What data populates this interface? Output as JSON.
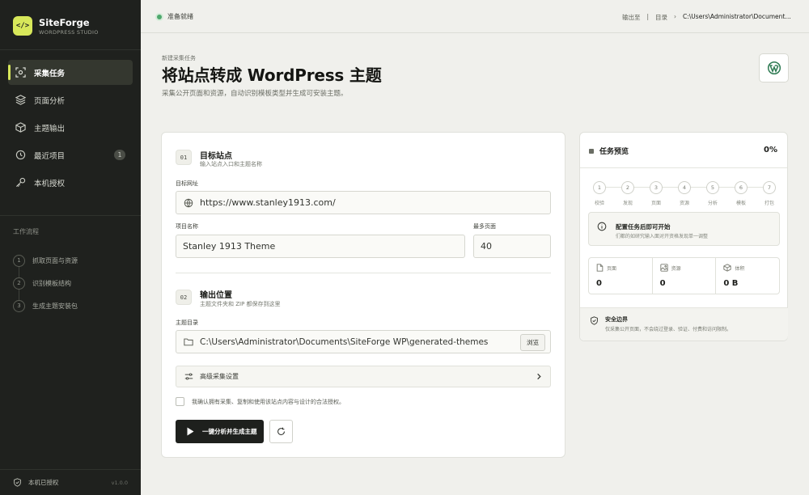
{
  "app": {
    "name": "SiteForge",
    "subtitle": "WORDPRESS STUDIO",
    "logo_glyph": "</>",
    "accent": "#d7e75a",
    "version": "v1.0.0"
  },
  "sidebar": {
    "items": [
      {
        "label": "采集任务",
        "icon": "scan-icon",
        "active": true
      },
      {
        "label": "页面分析",
        "icon": "layers-icon"
      },
      {
        "label": "主题输出",
        "icon": "box-icon"
      },
      {
        "label": "最近项目",
        "icon": "clock-icon",
        "badge": "1"
      },
      {
        "label": "本机授权",
        "icon": "key-icon"
      }
    ],
    "workflow_label": "工作流程",
    "workflow": [
      {
        "num": "1",
        "label": "抓取页面与资源"
      },
      {
        "num": "2",
        "label": "识别模板结构"
      },
      {
        "num": "3",
        "label": "生成主题安装包"
      }
    ],
    "footer": {
      "label": "本机已授权",
      "version": "v1.0.0"
    }
  },
  "topbar": {
    "status": "准备就绪",
    "breadcrumb": [
      "输出至",
      "目录"
    ],
    "path": "C:\\Users\\Administrator\\Documents\\SiteForge WP"
  },
  "header": {
    "eyebrow": "新建采集任务",
    "title": "将站点转成 WordPress 主题",
    "subtitle": "采集公开页面和资源，自动识别模板类型并生成可安装主题。"
  },
  "form": {
    "section1": {
      "no": "01",
      "title": "目标站点",
      "subtitle": "输入站点入口和主题名称"
    },
    "url_label": "目标网址",
    "url_value": "https://www.stanley1913.com/",
    "name_label": "项目名称",
    "name_value": "Stanley 1913 Theme",
    "pages_label": "最多页面",
    "pages_value": "40",
    "section2": {
      "no": "02",
      "title": "输出位置",
      "subtitle": "主题文件夹和 ZIP 都保存到这里"
    },
    "dir_label": "主题目录",
    "dir_value": "C:\\Users\\Administrator\\Documents\\SiteForge WP\\generated-themes",
    "browse_label": "浏览",
    "advanced_label": "高级采集设置",
    "consent_text": "我确认拥有采集、复制和使用该站点内容与设计的合法授权。",
    "run_label": "一键分析并生成主题"
  },
  "preview": {
    "title": "任务预览",
    "percent": "0%",
    "steps": [
      {
        "num": "1",
        "label": "校验"
      },
      {
        "num": "2",
        "label": "发现"
      },
      {
        "num": "3",
        "label": "页面"
      },
      {
        "num": "4",
        "label": "资源"
      },
      {
        "num": "5",
        "label": "分析"
      },
      {
        "num": "6",
        "label": "模板"
      },
      {
        "num": "7",
        "label": "打包"
      }
    ],
    "notice_title": "配置任务后即可开始",
    "notice_sub": "们都的如研究输入面对开资格发现单一调整",
    "stats": [
      {
        "label": "页面",
        "value": "0",
        "icon": "file-icon"
      },
      {
        "label": "资源",
        "value": "0",
        "icon": "image-icon"
      },
      {
        "label": "体积",
        "value": "0 B",
        "icon": "package-icon"
      }
    ],
    "security_title": "安全边界",
    "security_sub": "仅采集公开页面，不会绕过登录、验证、付费和访问限制。"
  }
}
